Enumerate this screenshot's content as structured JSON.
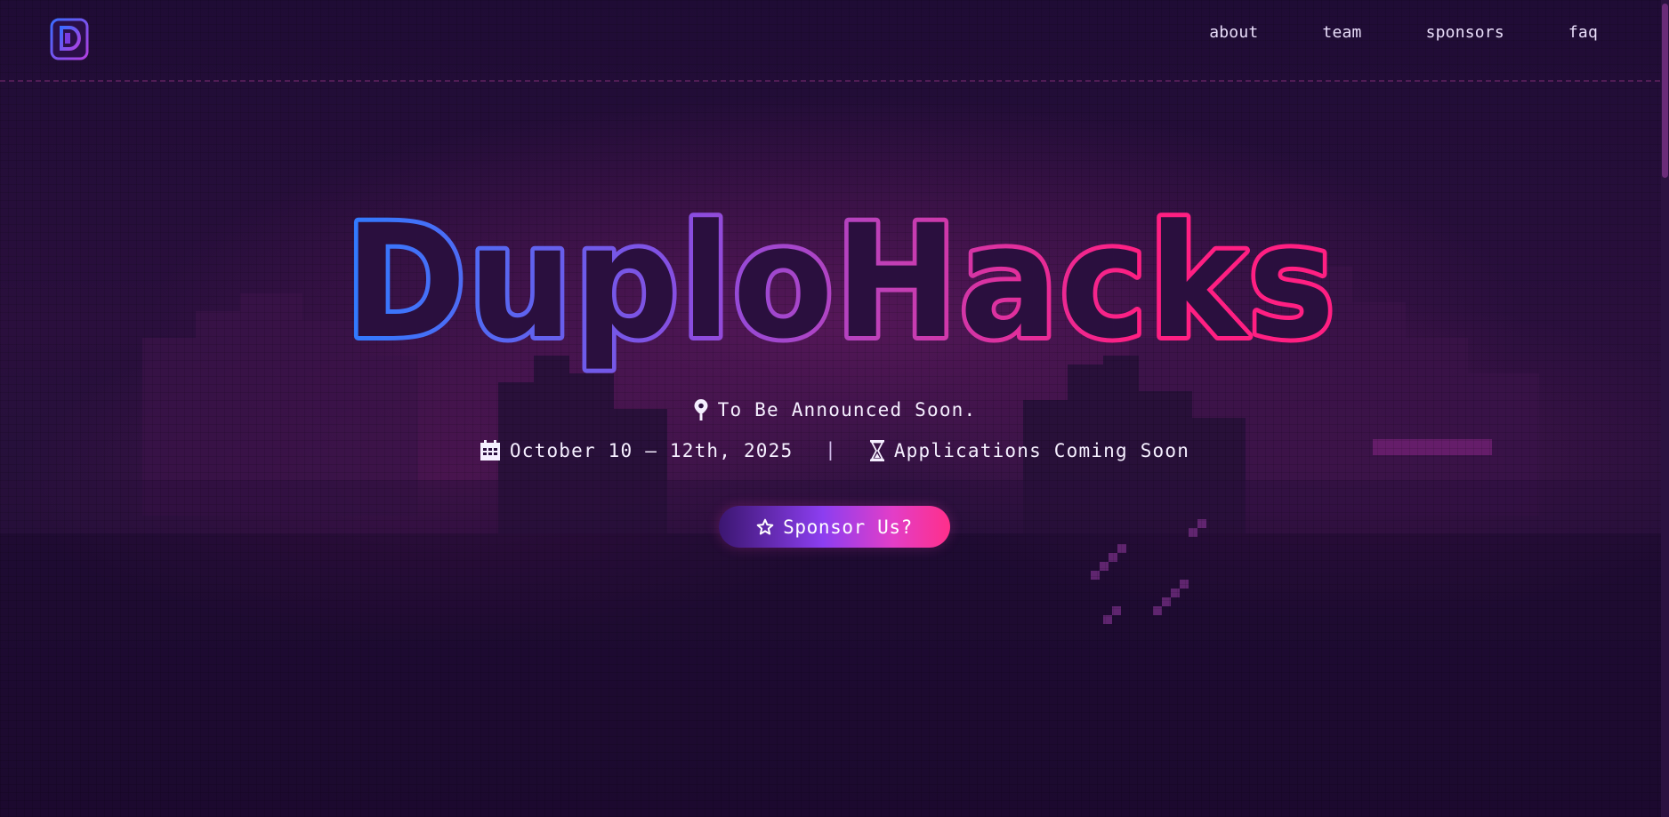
{
  "header": {
    "logo_icon": "duplohacks-logo-icon",
    "nav": [
      {
        "label": "about"
      },
      {
        "label": "team"
      },
      {
        "label": "sponsors"
      },
      {
        "label": "faq"
      }
    ]
  },
  "hero": {
    "title": "DuploHacks",
    "title_gradient": [
      "#2f7bff",
      "#8a4de0",
      "#c13fb6",
      "#ff1f82"
    ],
    "location_icon": "map-pin-icon",
    "location": "To Be Announced Soon.",
    "date_icon": "calendar-icon",
    "dates": "October 10 – 12th, 2025",
    "separator": "|",
    "applications_icon": "hourglass-icon",
    "applications": "Applications Coming Soon",
    "cta_icon": "star-icon",
    "cta_label": "Sponsor Us?"
  },
  "colors": {
    "background": "#1f0c35",
    "accent_blue": "#2f7bff",
    "accent_pink": "#ff1f82",
    "accent_purple": "#8c3ef0"
  }
}
